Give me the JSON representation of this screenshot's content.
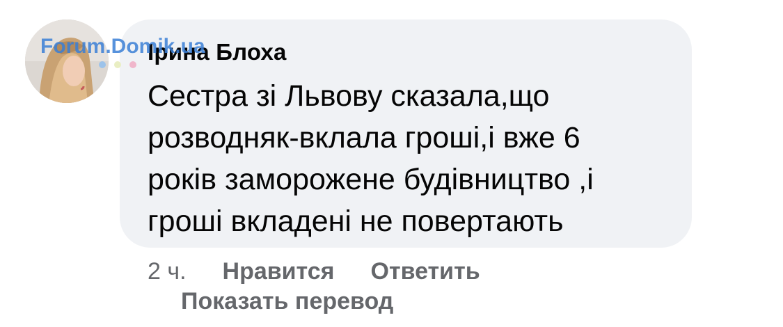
{
  "comment": {
    "author": "Ірина Блоха",
    "avatar_icon": "user-avatar-photo",
    "watermark": "Forum.Domik.ua",
    "watermark_color": "#3a7fd6",
    "text_lines": [
      "Сестра зі Львову сказала,що",
      "розводняк-вклала гроші,і вже 6",
      "років заморожене будівництво ,і",
      "гроші вкладені не повертають"
    ],
    "bubble_color": "#f0f2f5"
  },
  "actions": {
    "time": "2 ч.",
    "like_label": "Нравится",
    "reply_label": "Ответить",
    "translate_label": "Показать перевод"
  },
  "colors": {
    "text": "#050505",
    "secondary": "#65676b"
  }
}
